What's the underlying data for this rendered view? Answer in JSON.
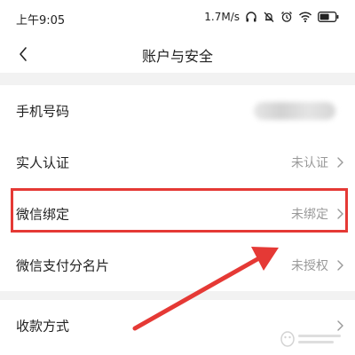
{
  "status_bar": {
    "time": "上午9:05",
    "network_speed": "1.7M/s",
    "icons": [
      "headphones-icon",
      "bell-muted-icon",
      "alarm-icon",
      "wifi-icon",
      "battery-icon"
    ]
  },
  "nav": {
    "title": "账户与安全",
    "back_icon": "chevron-left-icon"
  },
  "rows": [
    {
      "label": "手机号码",
      "value": ""
    },
    {
      "label": "实人认证",
      "value": "未认证"
    },
    {
      "label": "微信绑定",
      "value": "未绑定"
    },
    {
      "label": "微信支付分名片",
      "value": "未授权"
    },
    {
      "label": "收款方式",
      "value": ""
    }
  ],
  "colors": {
    "highlight": "#e53935",
    "arrow": "#e53935",
    "value_text": "#999999"
  }
}
